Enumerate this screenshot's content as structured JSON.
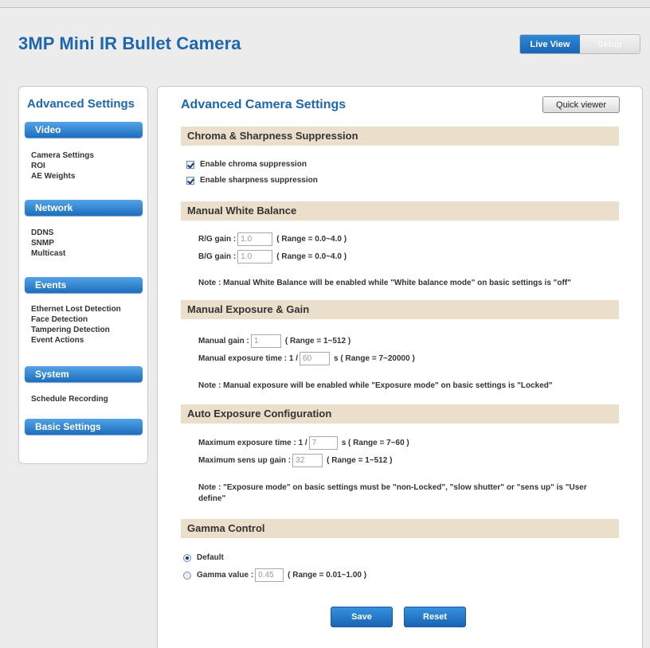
{
  "app": {
    "title": "3MP Mini IR Bullet Camera"
  },
  "top_tabs": [
    {
      "label": "Live View"
    },
    {
      "label": "Setup"
    }
  ],
  "sidebar": {
    "title": "Advanced Settings",
    "categories": [
      {
        "label": "Video",
        "items": [
          "Camera Settings",
          "ROI",
          "AE Weights"
        ]
      },
      {
        "label": "Network",
        "items": [
          "DDNS",
          "SNMP",
          "Multicast"
        ]
      },
      {
        "label": "Events",
        "items": [
          "Ethernet Lost Detection",
          "Face Detection",
          "Tampering Detection",
          "Event Actions"
        ]
      },
      {
        "label": "System",
        "items": [
          "Schedule Recording"
        ]
      },
      {
        "label": "Basic Settings",
        "items": []
      }
    ]
  },
  "main": {
    "title": "Advanced Camera Settings",
    "quick_viewer_label": "Quick viewer",
    "chroma": {
      "heading": "Chroma & Sharpness Suppression",
      "enable_chroma_label": "Enable chroma suppression",
      "enable_chroma_checked": true,
      "enable_sharpness_label": "Enable sharpness suppression",
      "enable_sharpness_checked": true
    },
    "white_balance": {
      "heading": "Manual White Balance",
      "rg_label": "R/G gain :",
      "rg_value": "1.0",
      "rg_range": "( Range = 0.0~4.0 )",
      "bg_label": "B/G gain :",
      "bg_value": "1.0",
      "bg_range": "( Range = 0.0~4.0 )",
      "note": "Note : Manual White Balance will be enabled while \"White balance mode\" on basic settings is \"off\""
    },
    "exposure": {
      "heading": "Manual Exposure & Gain",
      "gain_label": "Manual gain :",
      "gain_value": "1",
      "gain_range": "( Range = 1~512 )",
      "time_label": "Manual exposure time : 1 /",
      "time_value": "60",
      "time_range": "s ( Range = 7~20000 )",
      "note": "Note : Manual exposure will be enabled while \"Exposure mode\" on basic settings is \"Locked\""
    },
    "auto_exposure": {
      "heading": "Auto Exposure Configuration",
      "max_time_label": "Maximum exposure time : 1 /",
      "max_time_value": "7",
      "max_time_range": "s ( Range = 7~60 )",
      "max_gain_label": "Maximum sens up gain :",
      "max_gain_value": "32",
      "max_gain_range": "( Range = 1~512 )",
      "note": "Note : \"Exposure mode\" on basic settings must be \"non-Locked\", \"slow shutter\" or \"sens up\" is \"User define\""
    },
    "gamma": {
      "heading": "Gamma Control",
      "default_label": "Default",
      "default_selected": true,
      "value_label": "Gamma value :",
      "value": "0.45",
      "range": "( Range = 0.01~1.00 )"
    },
    "save_label": "Save",
    "reset_label": "Reset"
  }
}
